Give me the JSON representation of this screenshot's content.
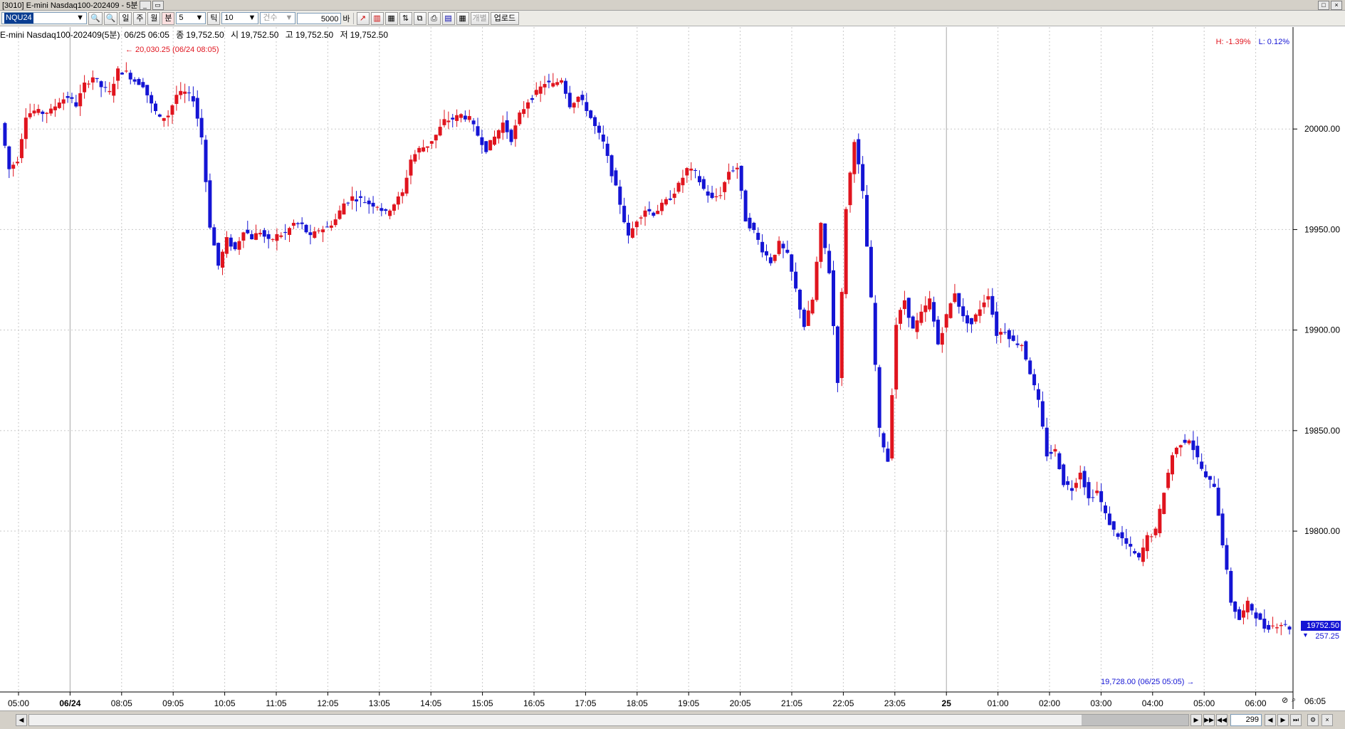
{
  "window": {
    "title": "[3010] E-mini Nasdaq100-202409 - 5분",
    "buttons": [
      "□",
      "×"
    ]
  },
  "toolbar": {
    "symbol": "NQU24",
    "period_day": "일",
    "period_week": "주",
    "period_month": "월",
    "period_minute": "분",
    "minute_value": "5",
    "tick_label": "틱",
    "tick_value": "10",
    "count_label": "건수",
    "bars_value": "5000",
    "bars_unit": "바",
    "individual_label": "개별",
    "upload_label": "업로드"
  },
  "info": {
    "name": "E-mini Nasdaq100-202409(5분)",
    "datetime": "06/25 06:05",
    "close_label": "종",
    "close": "19,752.50",
    "open_label": "시",
    "open": "19,752.50",
    "high_label": "고",
    "high": "19,752.50",
    "low_label": "저",
    "low": "19,752.50"
  },
  "hl": {
    "high_pct": "H: -1.39%",
    "low_pct": "L: 0.12%"
  },
  "annotations": {
    "max_label": "← 20,030.25 (06/24 08:05)",
    "min_label": "19,728.00 (06/25 05:05) →"
  },
  "current": {
    "price": "19752.50",
    "change": "257.25"
  },
  "bottom": {
    "bar_count": "299",
    "corner_time": "06:05"
  },
  "colors": {
    "up": "#e0141e",
    "down": "#1414d4",
    "grid": "#c8c8c8"
  },
  "chart_data": {
    "type": "candlestick",
    "y_ticks": [
      "20000.00",
      "19950.00",
      "19900.00",
      "19850.00",
      "19800.00"
    ],
    "ylim": [
      19720,
      20050
    ],
    "x_ticks": [
      "05:00",
      "06/24",
      "08:05",
      "09:05",
      "10:05",
      "11:05",
      "12:05",
      "13:05",
      "14:05",
      "15:05",
      "16:05",
      "17:05",
      "18:05",
      "19:05",
      "20:05",
      "21:05",
      "22:05",
      "23:05",
      "25",
      "01:00",
      "02:00",
      "03:00",
      "04:00",
      "05:00",
      "06:00"
    ],
    "close_path": [
      20003,
      19980,
      19985,
      20007,
      20009,
      20008,
      20009,
      20014,
      20016,
      20012,
      20022,
      20026,
      20021,
      20018,
      20029,
      20028,
      20024,
      20022,
      20012,
      20005,
      20007,
      20017,
      20018,
      20015,
      19996,
      19952,
      19932,
      19945,
      19940,
      19950,
      19946,
      19949,
      19944,
      19947,
      19948,
      19953,
      19952,
      19946,
      19950,
      19951,
      19955,
      19963,
      19966,
      19965,
      19963,
      19962,
      19958,
      19963,
      19968,
      19985,
      19990,
      19992,
      19997,
      20004,
      20005,
      20007,
      20005,
      19997,
      19990,
      19996,
      20003,
      19995,
      20007,
      20014,
      20018,
      20023,
      20022,
      20025,
      20012,
      20016,
      20010,
      20001,
      19993,
      19978,
      19963,
      19946,
      19955,
      19960,
      19958,
      19962,
      19966,
      19972,
      19980,
      19978,
      19970,
      19965,
      19968,
      19979,
      19981,
      19955,
      19949,
      19940,
      19934,
      19943,
      19937,
      19920,
      19902,
      19915,
      19952,
      19929,
      19875,
      19961,
      19995,
      19968,
      19915,
      19850,
      19835,
      19903,
      19915,
      19900,
      19908,
      19915,
      19893,
      19907,
      19919,
      19906,
      19903,
      19911,
      19918,
      19898,
      19900,
      19894,
      19893,
      19879,
      19864,
      19838,
      19840,
      19824,
      19821,
      19830,
      19816,
      19820,
      19808,
      19800,
      19796,
      19791,
      19786,
      19797,
      19800,
      19820,
      19838,
      19844,
      19846,
      19836,
      19826,
      19823,
      19794,
      19765,
      19756,
      19764,
      19758,
      19752,
      19753,
      19754,
      19752
    ]
  }
}
